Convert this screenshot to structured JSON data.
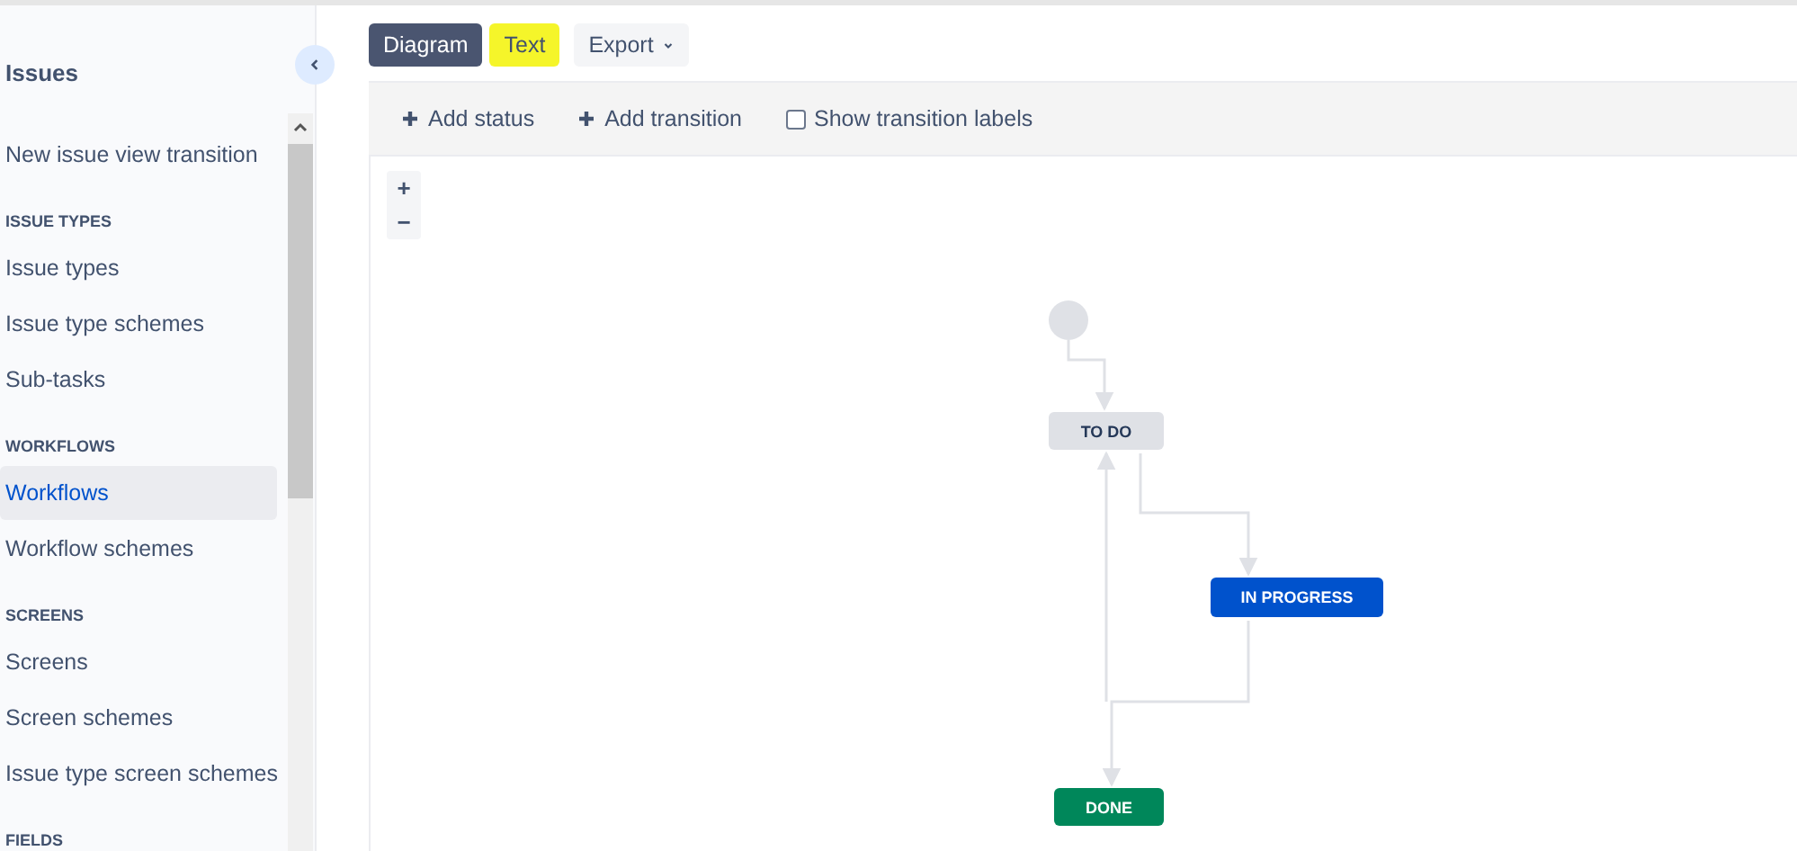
{
  "sidebar": {
    "title": "Issues",
    "groups": [
      {
        "items": [
          {
            "label": "New issue view transition",
            "selected": false
          }
        ]
      },
      {
        "heading": "ISSUE TYPES",
        "items": [
          {
            "label": "Issue types",
            "selected": false
          },
          {
            "label": "Issue type schemes",
            "selected": false
          },
          {
            "label": "Sub-tasks",
            "selected": false
          }
        ]
      },
      {
        "heading": "WORKFLOWS",
        "items": [
          {
            "label": "Workflows",
            "selected": true
          },
          {
            "label": "Workflow schemes",
            "selected": false
          }
        ]
      },
      {
        "heading": "SCREENS",
        "items": [
          {
            "label": "Screens",
            "selected": false
          },
          {
            "label": "Screen schemes",
            "selected": false
          },
          {
            "label": "Issue type screen schemes",
            "selected": false
          }
        ]
      },
      {
        "heading": "FIELDS"
      }
    ]
  },
  "view_tabs": [
    {
      "label": "Diagram",
      "selected": true,
      "highlighted": false
    },
    {
      "label": "Text",
      "selected": false,
      "highlighted": true
    }
  ],
  "export_button": {
    "label": "Export"
  },
  "toolbar": {
    "add_status": "Add status",
    "add_transition": "Add transition",
    "show_labels": {
      "label": "Show transition labels",
      "checked": false
    }
  },
  "zoom": {
    "in": "+",
    "out": "−"
  },
  "diagram": {
    "statuses": [
      {
        "label": "TO DO",
        "kind": "todo"
      },
      {
        "label": "IN PROGRESS",
        "kind": "inprogress"
      },
      {
        "label": "DONE",
        "kind": "done"
      }
    ]
  }
}
